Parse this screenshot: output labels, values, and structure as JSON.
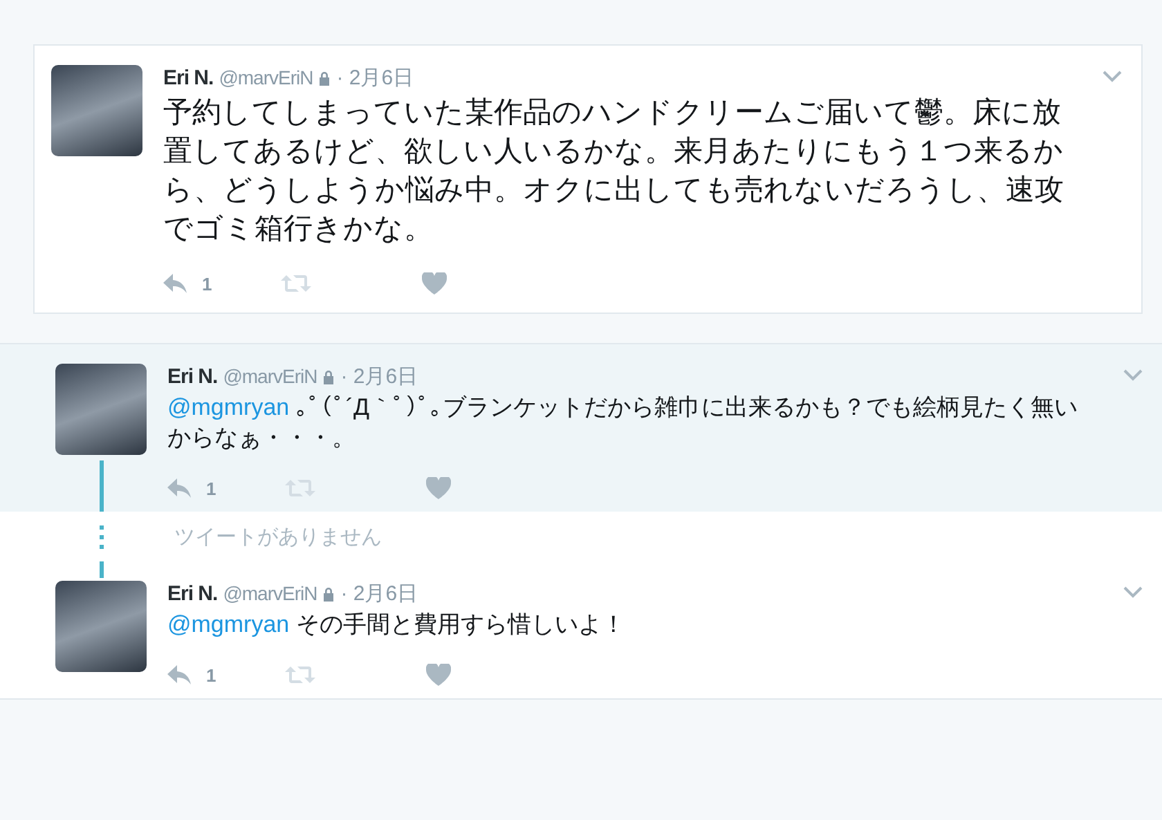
{
  "focused_tweet": {
    "name": "Eri N.",
    "handle": "@marvEriN",
    "protected": true,
    "date": "· 2月6日",
    "text": "予約してしまっていた某作品のハンドクリームご届いて鬱。床に放置してあるけど、欲しい人いるかな。来月あたりにもう１つ来るから、どうしようか悩み中。オクに出しても売れないだろうし、速攻でゴミ箱行きかな。",
    "reply_count": "1"
  },
  "thread": [
    {
      "kind": "tweet",
      "highlighted": true,
      "name": "Eri N.",
      "handle": "@marvEriN",
      "protected": true,
      "date": "· 2月6日",
      "mention": "@mgmryan",
      "text": "｡ﾟ(ﾟ´Д｀ﾟ)ﾟ｡ブランケットだから雑巾に出来るかも？でも絵柄見たく無いからなぁ・・・。",
      "reply_count": "1"
    },
    {
      "kind": "missing",
      "text": "ツイートがありません"
    },
    {
      "kind": "tweet",
      "highlighted": false,
      "name": "Eri N.",
      "handle": "@marvEriN",
      "protected": true,
      "date": "· 2月6日",
      "mention": "@mgmryan",
      "text": "その手間と費用すら惜しいよ！",
      "reply_count": "1"
    }
  ]
}
